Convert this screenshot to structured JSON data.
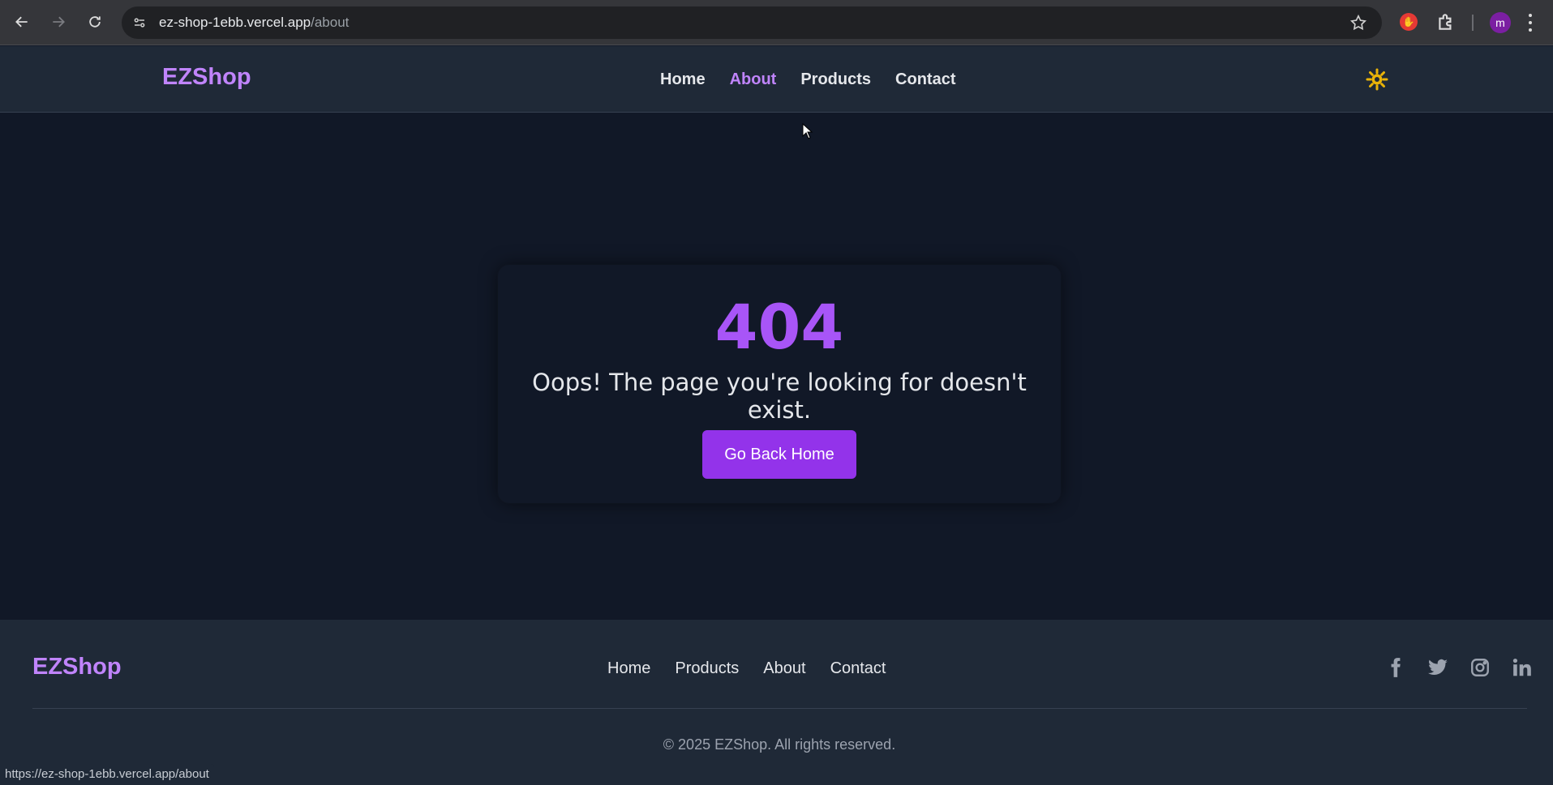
{
  "browser": {
    "url_host": "ez-shop-1ebb.vercel.app",
    "url_path": "/about",
    "profile_initial": "m",
    "status_url": "https://ez-shop-1ebb.vercel.app/about"
  },
  "nav": {
    "brand": "EZShop",
    "links": [
      "Home",
      "About",
      "Products",
      "Contact"
    ],
    "active": "About",
    "theme_icon": "sun-icon"
  },
  "error": {
    "code": "404",
    "message": "Oops! The page you're looking for doesn't exist.",
    "button_label": "Go Back Home"
  },
  "footer": {
    "brand": "EZShop",
    "links": [
      "Home",
      "Products",
      "About",
      "Contact"
    ],
    "socials": [
      "facebook-icon",
      "twitter-icon",
      "instagram-icon",
      "linkedin-icon"
    ],
    "copyright": "© 2025 EZShop. All rights reserved."
  },
  "colors": {
    "accent": "#a855f7",
    "brand": "#c084fc",
    "button": "#9333ea",
    "background": "#111827",
    "surface": "#1f2937"
  }
}
